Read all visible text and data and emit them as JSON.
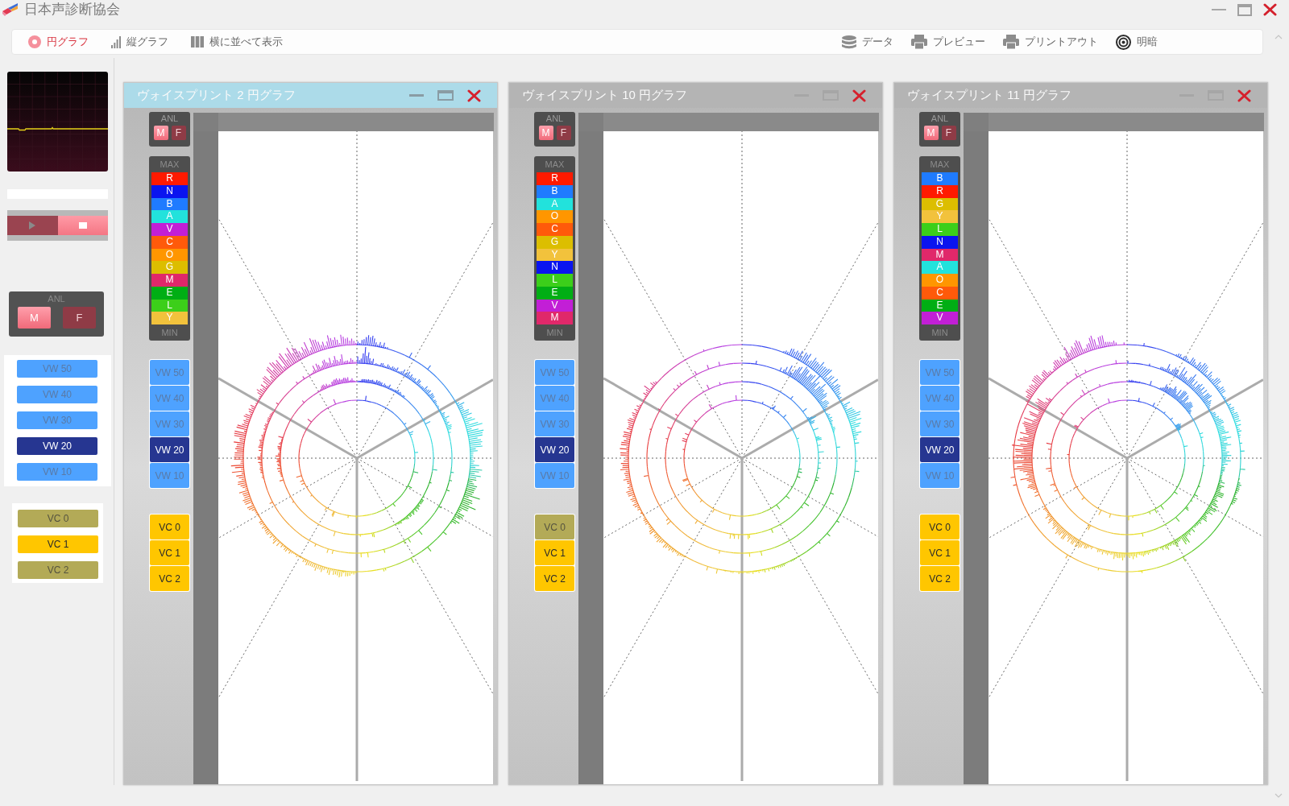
{
  "window": {
    "title": "日本声診断協会"
  },
  "toolbar": {
    "views": [
      {
        "kind": "pie",
        "label": "円グラフ",
        "selected": true
      },
      {
        "kind": "bar",
        "label": "縦グラフ",
        "selected": false
      },
      {
        "kind": "columns",
        "label": "横に並べて表示",
        "selected": false
      }
    ],
    "actions": [
      {
        "kind": "database",
        "label": "データ"
      },
      {
        "kind": "printer",
        "label": "プレビュー"
      },
      {
        "kind": "printer",
        "label": "プリントアウト"
      },
      {
        "kind": "contrast",
        "label": "明暗"
      }
    ]
  },
  "sidebar": {
    "transport": [
      {
        "kind": "play",
        "selected": false
      },
      {
        "kind": "stop",
        "selected": true
      }
    ],
    "anl": {
      "label": "ANL",
      "buttons": [
        {
          "label": "M",
          "selected": true
        },
        {
          "label": "F",
          "selected": false
        }
      ]
    },
    "vw_buttons": [
      {
        "label": "VW 50",
        "selected": false
      },
      {
        "label": "VW 40",
        "selected": false
      },
      {
        "label": "VW 30",
        "selected": false
      },
      {
        "label": "VW 20",
        "selected": true
      },
      {
        "label": "VW 10",
        "selected": false
      }
    ],
    "vc_buttons": [
      {
        "label": "VC 0",
        "selected": false
      },
      {
        "label": "VC 1",
        "selected": true
      },
      {
        "label": "VC 2",
        "selected": false
      }
    ]
  },
  "panels": [
    {
      "title": "ヴォイスプリント 2 円グラフ",
      "active": true,
      "anl": {
        "label": "ANL",
        "buttons": [
          {
            "label": "M",
            "selected": true
          },
          {
            "label": "F",
            "selected": false
          }
        ]
      },
      "scale": {
        "max_label": "MAX",
        "min_label": "MIN",
        "tones": [
          {
            "label": "R",
            "color": "#ff1a00"
          },
          {
            "label": "N",
            "color": "#0a14f0"
          },
          {
            "label": "B",
            "color": "#1f7bff"
          },
          {
            "label": "A",
            "color": "#22e2dc"
          },
          {
            "label": "V",
            "color": "#c21fd6"
          },
          {
            "label": "C",
            "color": "#ff5a0a"
          },
          {
            "label": "O",
            "color": "#ff9600"
          },
          {
            "label": "G",
            "color": "#dcbe00"
          },
          {
            "label": "M",
            "color": "#e0286a"
          },
          {
            "label": "E",
            "color": "#00ae14"
          },
          {
            "label": "L",
            "color": "#3ccf1a"
          },
          {
            "label": "Y",
            "color": "#f2c23c"
          }
        ]
      },
      "vw_buttons": [
        {
          "label": "VW 50",
          "selected": false
        },
        {
          "label": "VW 40",
          "selected": false
        },
        {
          "label": "VW 30",
          "selected": false
        },
        {
          "label": "VW 20",
          "selected": true
        },
        {
          "label": "VW 10",
          "selected": false
        }
      ],
      "vc_buttons": [
        {
          "label": "VC 0",
          "selected": true
        },
        {
          "label": "VC 1",
          "selected": true
        },
        {
          "label": "VC 2",
          "selected": true
        }
      ]
    },
    {
      "title": "ヴォイスプリント 10 円グラフ",
      "active": false,
      "anl": {
        "label": "ANL",
        "buttons": [
          {
            "label": "M",
            "selected": true
          },
          {
            "label": "F",
            "selected": false
          }
        ]
      },
      "scale": {
        "max_label": "MAX",
        "min_label": "MIN",
        "tones": [
          {
            "label": "R",
            "color": "#ff1a00"
          },
          {
            "label": "B",
            "color": "#1f7bff"
          },
          {
            "label": "A",
            "color": "#22e2dc"
          },
          {
            "label": "O",
            "color": "#ff9600"
          },
          {
            "label": "C",
            "color": "#ff5a0a"
          },
          {
            "label": "G",
            "color": "#dcbe00"
          },
          {
            "label": "Y",
            "color": "#f2c23c"
          },
          {
            "label": "N",
            "color": "#0a14f0"
          },
          {
            "label": "L",
            "color": "#3ccf1a"
          },
          {
            "label": "E",
            "color": "#00ae14"
          },
          {
            "label": "V",
            "color": "#c21fd6"
          },
          {
            "label": "M",
            "color": "#e0286a"
          }
        ]
      },
      "vw_buttons": [
        {
          "label": "VW 50",
          "selected": false
        },
        {
          "label": "VW 40",
          "selected": false
        },
        {
          "label": "VW 30",
          "selected": false
        },
        {
          "label": "VW 20",
          "selected": true
        },
        {
          "label": "VW 10",
          "selected": false
        }
      ],
      "vc_buttons": [
        {
          "label": "VC 0",
          "selected": false
        },
        {
          "label": "VC 1",
          "selected": true
        },
        {
          "label": "VC 2",
          "selected": true
        }
      ]
    },
    {
      "title": "ヴォイスプリント 11 円グラフ",
      "active": false,
      "anl": {
        "label": "ANL",
        "buttons": [
          {
            "label": "M",
            "selected": true
          },
          {
            "label": "F",
            "selected": false
          }
        ]
      },
      "scale": {
        "max_label": "MAX",
        "min_label": "MIN",
        "tones": [
          {
            "label": "B",
            "color": "#1f7bff"
          },
          {
            "label": "R",
            "color": "#ff1a00"
          },
          {
            "label": "G",
            "color": "#dcbe00"
          },
          {
            "label": "Y",
            "color": "#f2c23c"
          },
          {
            "label": "L",
            "color": "#3ccf1a"
          },
          {
            "label": "N",
            "color": "#0a14f0"
          },
          {
            "label": "M",
            "color": "#e0286a"
          },
          {
            "label": "A",
            "color": "#22e2dc"
          },
          {
            "label": "O",
            "color": "#ff9600"
          },
          {
            "label": "C",
            "color": "#ff5a0a"
          },
          {
            "label": "E",
            "color": "#00ae14"
          },
          {
            "label": "V",
            "color": "#c21fd6"
          }
        ]
      },
      "vw_buttons": [
        {
          "label": "VW 50",
          "selected": false
        },
        {
          "label": "VW 40",
          "selected": false
        },
        {
          "label": "VW 30",
          "selected": false
        },
        {
          "label": "VW 20",
          "selected": true
        },
        {
          "label": "VW 10",
          "selected": false
        }
      ],
      "vc_buttons": [
        {
          "label": "VC 0",
          "selected": true
        },
        {
          "label": "VC 1",
          "selected": true
        },
        {
          "label": "VC 2",
          "selected": true
        }
      ]
    }
  ]
}
